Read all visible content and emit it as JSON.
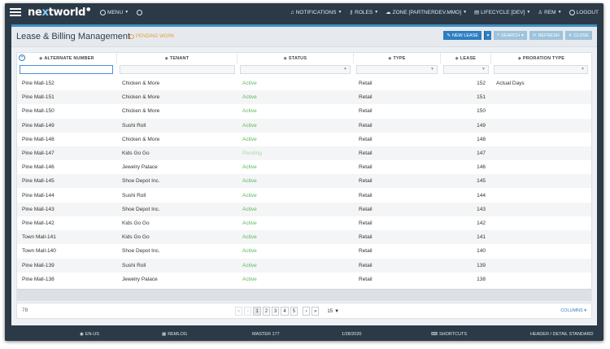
{
  "topbar": {
    "logo_pre": "ne",
    "logo_x": "x",
    "logo_post": "tworld",
    "menu_label": "MENU",
    "notifications_label": "NOTIFICATIONS",
    "roles_label": "ROLES",
    "zone_label": "ZONE [PARTNERDEV.MMO]",
    "lifecycle_label": "LIFECYCLE [DEV]",
    "user_label": "REM",
    "logout_label": "LOGOUT"
  },
  "page": {
    "title": "Lease & Billing Management",
    "pending_label": "PENDING WORK"
  },
  "actions": {
    "new_lease": "NEW LEASE",
    "search": "SEARCH",
    "refresh": "REFRESH",
    "close": "CLOSE"
  },
  "columns": {
    "alternate_number": "ALTERNATE NUMBER",
    "tenant": "TENANT",
    "status": "STATUS",
    "type": "TYPE",
    "lease": "LEASE",
    "proration_type": "PRORATION TYPE"
  },
  "rows": [
    {
      "alt": "Pine Mall-152",
      "tenant": "Chicken & More",
      "status": "Active",
      "type": "Retail",
      "lease": "152",
      "proration": "Actual Days"
    },
    {
      "alt": "Pine Mall-151",
      "tenant": "Chicken & More",
      "status": "Active",
      "type": "Retail",
      "lease": "151",
      "proration": ""
    },
    {
      "alt": "Pine Mall-150",
      "tenant": "Chicken & More",
      "status": "Active",
      "type": "Retail",
      "lease": "150",
      "proration": ""
    },
    {
      "alt": "Pine Mall-149",
      "tenant": "Sushi Roll",
      "status": "Active",
      "type": "Retail",
      "lease": "149",
      "proration": ""
    },
    {
      "alt": "Pine Mall-148",
      "tenant": "Chicken & More",
      "status": "Active",
      "type": "Retail",
      "lease": "148",
      "proration": ""
    },
    {
      "alt": "Pine Mall-147",
      "tenant": "Kids Go Go",
      "status": "Pending",
      "type": "Retail",
      "lease": "147",
      "proration": ""
    },
    {
      "alt": "Pine Mall-146",
      "tenant": "Jewelry Palace",
      "status": "Active",
      "type": "Retail",
      "lease": "146",
      "proration": ""
    },
    {
      "alt": "Pine Mall-145",
      "tenant": "Shoe Depot Inc.",
      "status": "Active",
      "type": "Retail",
      "lease": "145",
      "proration": ""
    },
    {
      "alt": "Pine Mall-144",
      "tenant": "Sushi Roll",
      "status": "Active",
      "type": "Retail",
      "lease": "144",
      "proration": ""
    },
    {
      "alt": "Pine Mall-143",
      "tenant": "Shoe Depot Inc.",
      "status": "Active",
      "type": "Retail",
      "lease": "143",
      "proration": ""
    },
    {
      "alt": "Pine Mall-142",
      "tenant": "Kids Go Go",
      "status": "Active",
      "type": "Retail",
      "lease": "142",
      "proration": ""
    },
    {
      "alt": "Town Mall-141",
      "tenant": "Kids Go Go",
      "status": "Active",
      "type": "Retail",
      "lease": "141",
      "proration": ""
    },
    {
      "alt": "Town Mall-140",
      "tenant": "Shoe Depot Inc.",
      "status": "Active",
      "type": "Retail",
      "lease": "140",
      "proration": ""
    },
    {
      "alt": "Pine Mall-139",
      "tenant": "Sushi Roll",
      "status": "Active",
      "type": "Retail",
      "lease": "139",
      "proration": ""
    },
    {
      "alt": "Pine Mall-138",
      "tenant": "Jewelry Palace",
      "status": "Active",
      "type": "Retail",
      "lease": "138",
      "proration": ""
    }
  ],
  "pager": {
    "total": "78",
    "pages": [
      "1",
      "2",
      "3",
      "4",
      "5"
    ],
    "page_size": "15",
    "columns_label": "COLUMNS"
  },
  "statusbar": {
    "locale": "EN-US",
    "remlog": "REMLOG",
    "master": "MASTER 177",
    "date": "1/28/2020",
    "shortcuts": "SHORTCUTS",
    "standard": "HEADER / DETAIL STANDARD"
  },
  "colors": {
    "accent": "#2f7fc1",
    "active_status": "#5bb85b",
    "pending": "#e0a040",
    "chrome": "#2c3947"
  }
}
